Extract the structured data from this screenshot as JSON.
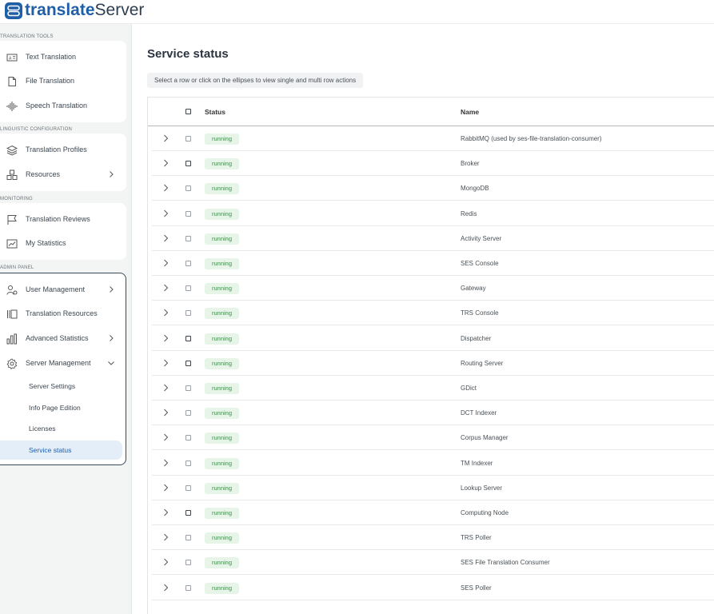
{
  "header": {
    "logo_part1": "translate",
    "logo_part2": "Server",
    "icon": "translate-server-logo"
  },
  "sidebar": {
    "sections": [
      {
        "label": "TRANSLATION TOOLS",
        "items": [
          {
            "label": "Text Translation",
            "icon": "text-translation-icon"
          },
          {
            "label": "File Translation",
            "icon": "file-icon"
          },
          {
            "label": "Speech Translation",
            "icon": "waveform-icon"
          }
        ]
      },
      {
        "label": "LINGUISTIC CONFIGURATION",
        "items": [
          {
            "label": "Translation Profiles",
            "icon": "layers-icon"
          },
          {
            "label": "Resources",
            "icon": "cubes-icon",
            "has_chevron": true
          }
        ]
      },
      {
        "label": "MONITORING",
        "items": [
          {
            "label": "Translation Reviews",
            "icon": "flag-icon"
          },
          {
            "label": "My Statistics",
            "icon": "statistics-icon"
          }
        ]
      },
      {
        "label": "ADMIN PANEL",
        "items": [
          {
            "label": "User Management",
            "icon": "user-gear-icon",
            "has_chevron": true
          },
          {
            "label": "Translation Resources",
            "icon": "book-stack-icon"
          },
          {
            "label": "Advanced Statistics",
            "icon": "bar-chart-icon",
            "has_chevron": true
          },
          {
            "label": "Server Management",
            "icon": "gear-icon",
            "has_chevron": true,
            "expanded": true
          }
        ],
        "subitems": [
          {
            "label": "Server Settings"
          },
          {
            "label": "Info Page Edition"
          },
          {
            "label": "Licenses"
          },
          {
            "label": "Service status",
            "active": true
          }
        ]
      }
    ]
  },
  "main": {
    "title": "Service status",
    "hint": "Select a row or click on the ellipses to view single and multi row actions",
    "table": {
      "columns": {
        "status": "Status",
        "name": "Name"
      },
      "rows": [
        {
          "status": "running",
          "name": "RabbitMQ (used by ses-file-translation-consumer)",
          "cb_dark": false
        },
        {
          "status": "running",
          "name": "Broker",
          "cb_dark": true
        },
        {
          "status": "running",
          "name": "MongoDB",
          "cb_dark": false
        },
        {
          "status": "running",
          "name": "Redis",
          "cb_dark": false
        },
        {
          "status": "running",
          "name": "Activity Server",
          "cb_dark": false
        },
        {
          "status": "running",
          "name": "SES Console",
          "cb_dark": false
        },
        {
          "status": "running",
          "name": "Gateway",
          "cb_dark": false
        },
        {
          "status": "running",
          "name": "TRS Console",
          "cb_dark": false
        },
        {
          "status": "running",
          "name": "Dispatcher",
          "cb_dark": true
        },
        {
          "status": "running",
          "name": "Routing Server",
          "cb_dark": true
        },
        {
          "status": "running",
          "name": "GDict",
          "cb_dark": false
        },
        {
          "status": "running",
          "name": "DCT Indexer",
          "cb_dark": false
        },
        {
          "status": "running",
          "name": "Corpus Manager",
          "cb_dark": false
        },
        {
          "status": "running",
          "name": "TM Indexer",
          "cb_dark": false
        },
        {
          "status": "running",
          "name": "Lookup Server",
          "cb_dark": false
        },
        {
          "status": "running",
          "name": "Computing Node",
          "cb_dark": true
        },
        {
          "status": "running",
          "name": "TRS Poller",
          "cb_dark": false
        },
        {
          "status": "running",
          "name": "SES File Translation Consumer",
          "cb_dark": false
        },
        {
          "status": "running",
          "name": "SES Poller",
          "cb_dark": false
        }
      ]
    }
  },
  "colors": {
    "brand": "#1f5fa8",
    "status_bg": "#e6f5e8",
    "status_text": "#3f8b4b",
    "active_bg": "#e4eef8"
  }
}
